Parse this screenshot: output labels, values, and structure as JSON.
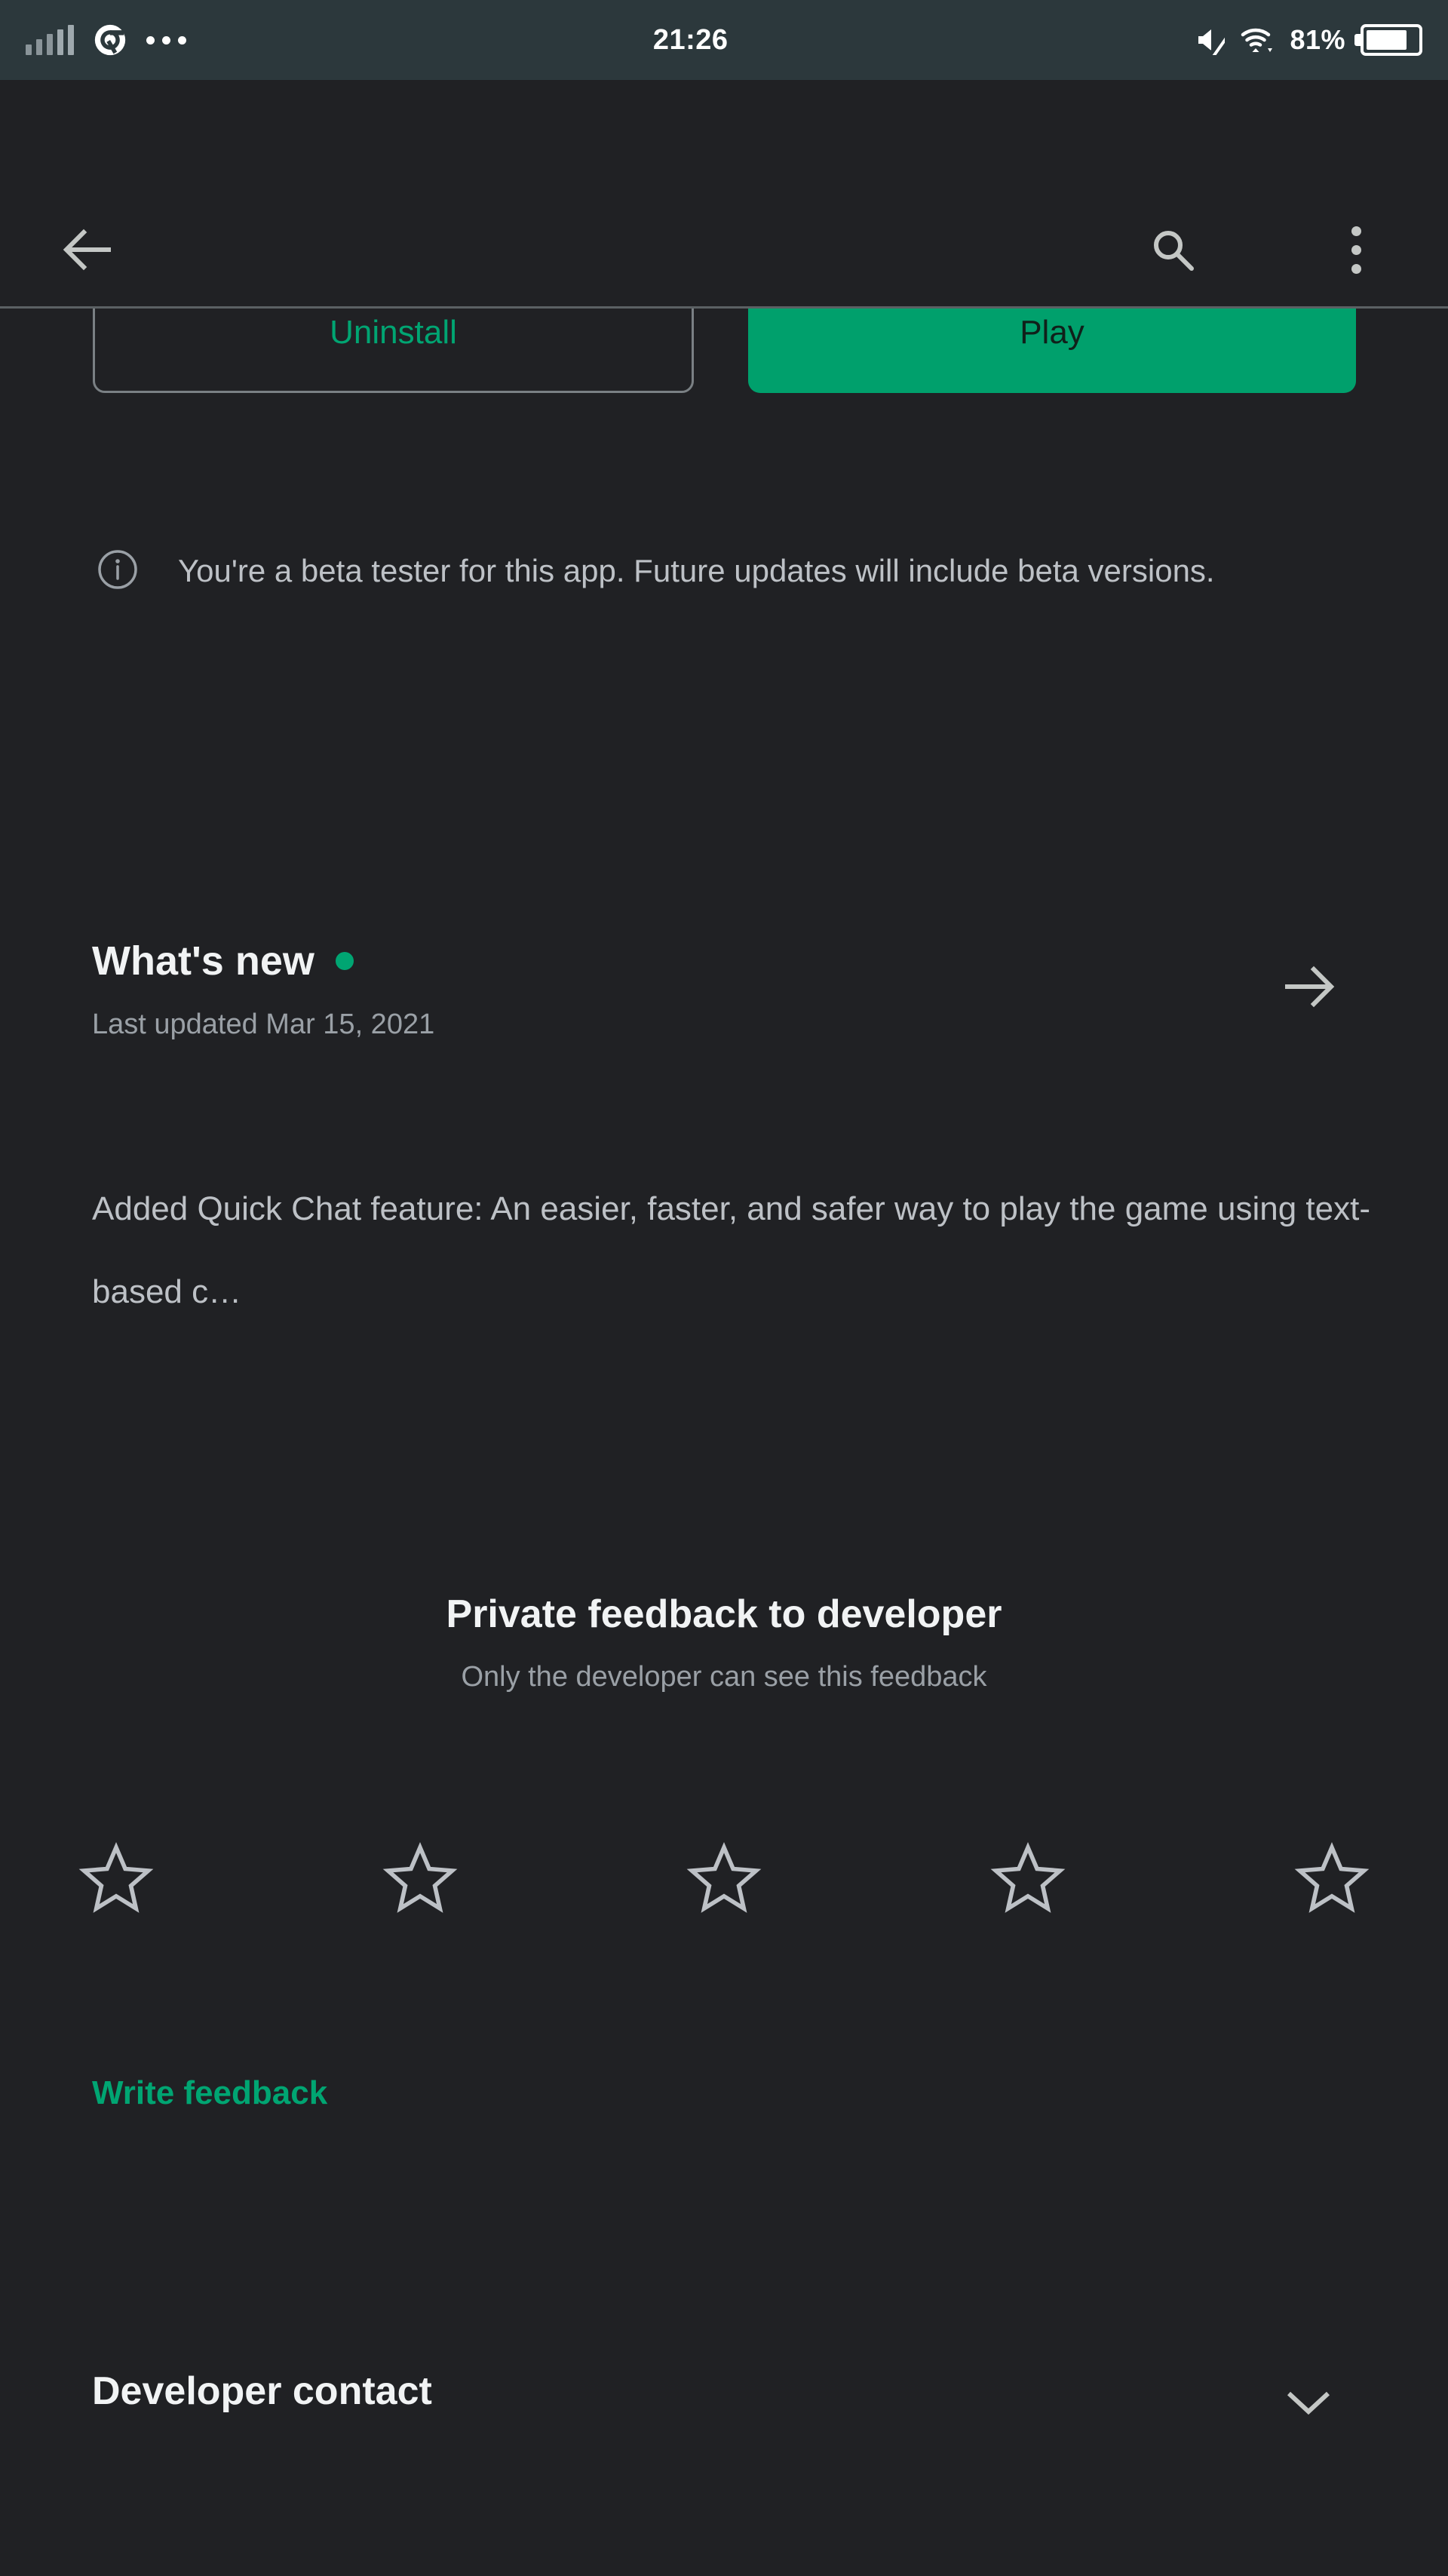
{
  "status_bar": {
    "time": "21:26",
    "battery_percent": "81%",
    "icons": {
      "signal": "signal-bars-icon",
      "chrome": "chrome-icon",
      "overflow": "three-dots-horizontal-icon",
      "mute": "volume-muted-icon",
      "wifi": "wifi-icon",
      "battery": "battery-icon"
    },
    "bg_color": "#2C383C"
  },
  "toolbar": {
    "back_icon": "arrow-left-icon",
    "search_icon": "search-icon",
    "menu_icon": "more-vertical-icon"
  },
  "cta": {
    "uninstall_label": "Uninstall",
    "play_label": "Play",
    "accent_color": "#00A572",
    "play_bg_color": "#00A06C"
  },
  "beta_notice": {
    "icon": "info-circle-icon",
    "text": "You're a beta tester for this app. Future updates will include beta versions."
  },
  "whats_new": {
    "title": "What's new",
    "badge_color": "#00A572",
    "last_updated": "Last updated Mar 15, 2021",
    "arrow_icon": "arrow-right-icon",
    "body": "Added Quick Chat feature: An easier, faster, and safer way to play the game using text-based c…"
  },
  "private_feedback": {
    "title": "Private feedback to developer",
    "subtitle": "Only the developer can see this feedback",
    "rating_value": 0,
    "stars": [
      {
        "index": 1,
        "filled": false,
        "name": "star-1"
      },
      {
        "index": 2,
        "filled": false,
        "name": "star-2"
      },
      {
        "index": 3,
        "filled": false,
        "name": "star-3"
      },
      {
        "index": 4,
        "filled": false,
        "name": "star-4"
      },
      {
        "index": 5,
        "filled": false,
        "name": "star-5"
      }
    ],
    "write_feedback_label": "Write feedback"
  },
  "developer_contact": {
    "title": "Developer contact",
    "chevron_icon": "chevron-down-icon",
    "expanded": false
  },
  "page": {
    "background_color": "#202124"
  }
}
